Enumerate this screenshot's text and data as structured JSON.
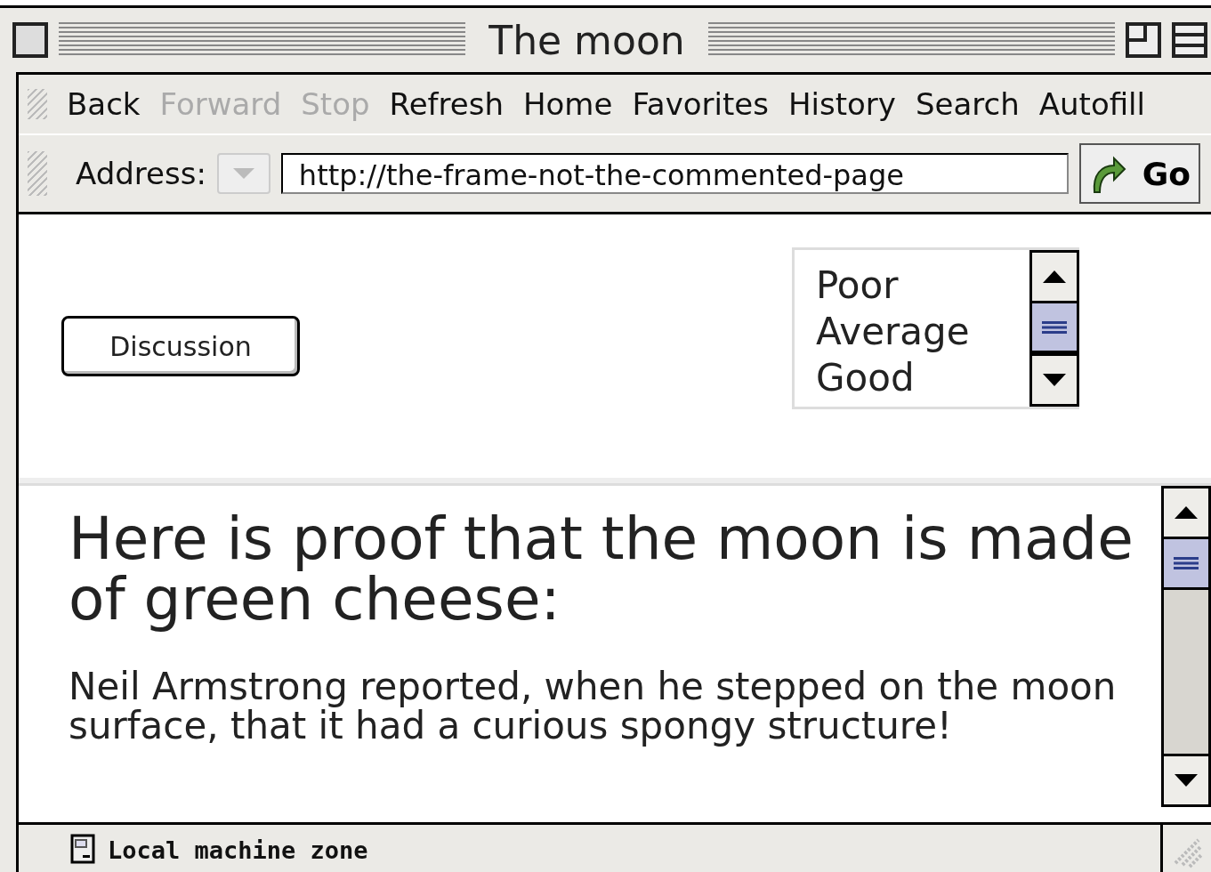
{
  "window": {
    "title": "The moon"
  },
  "toolbar": [
    {
      "label": "Back",
      "disabled": false
    },
    {
      "label": "Forward",
      "disabled": true
    },
    {
      "label": "Stop",
      "disabled": true
    },
    {
      "label": "Refresh",
      "disabled": false
    },
    {
      "label": "Home",
      "disabled": false
    },
    {
      "label": "Favorites",
      "disabled": false
    },
    {
      "label": "History",
      "disabled": false
    },
    {
      "label": "Search",
      "disabled": false
    },
    {
      "label": "Autofill",
      "disabled": false
    }
  ],
  "address": {
    "label": "Address:",
    "value": "http://the-frame-not-the-commented-page",
    "go": "Go"
  },
  "top_frame": {
    "button": "Discussion",
    "list": [
      "Poor",
      "Average",
      "Good"
    ]
  },
  "bottom_frame": {
    "heading": "Here is proof that the moon is made of green cheese:",
    "paragraph": "Neil Armstrong reported, when he stepped on the moon surface, that it had a curious spongy structure!"
  },
  "status_bar": {
    "text": "Local machine zone"
  }
}
